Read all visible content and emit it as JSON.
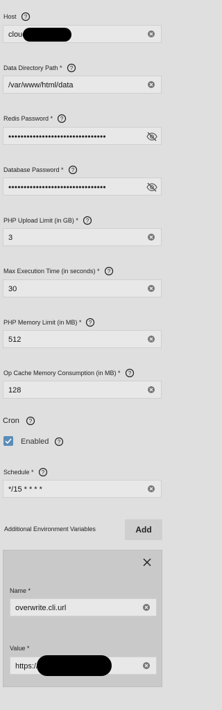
{
  "host": {
    "label": "Host",
    "value": "cloud"
  },
  "data_directory": {
    "label": "Data Directory Path *",
    "value": "/var/www/html/data"
  },
  "redis_password": {
    "label": "Redis Password *",
    "value": "••••••••••••••••••••••••••••••••"
  },
  "database_password": {
    "label": "Database Password *",
    "value": "••••••••••••••••••••••••••••••••"
  },
  "php_upload_limit": {
    "label": "PHP Upload Limit (in GB) *",
    "value": "3"
  },
  "max_execution_time": {
    "label": "Max Execution Time (in seconds) *",
    "value": "30"
  },
  "php_memory_limit": {
    "label": "PHP Memory Limit (in MB) *",
    "value": "512"
  },
  "op_cache": {
    "label": "Op Cache Memory Consumption (in MB) *",
    "value": "128"
  },
  "cron": {
    "label": "Cron",
    "enabled_label": "Enabled",
    "enabled": true
  },
  "schedule": {
    "label": "Schedule *",
    "value": "*/15 * * * *"
  },
  "env_vars": {
    "label": "Additional Environment Variables",
    "add_label": "Add",
    "items": [
      {
        "name_label": "Name *",
        "name_value": "overwrite.cli.url",
        "value_label": "Value *",
        "value_value": "https://"
      }
    ]
  },
  "icons": {
    "help": "help-circle-icon",
    "clear": "clear-x-icon",
    "visibility": "eye-off-icon",
    "checkbox": "checkmark-icon",
    "close": "close-icon"
  }
}
